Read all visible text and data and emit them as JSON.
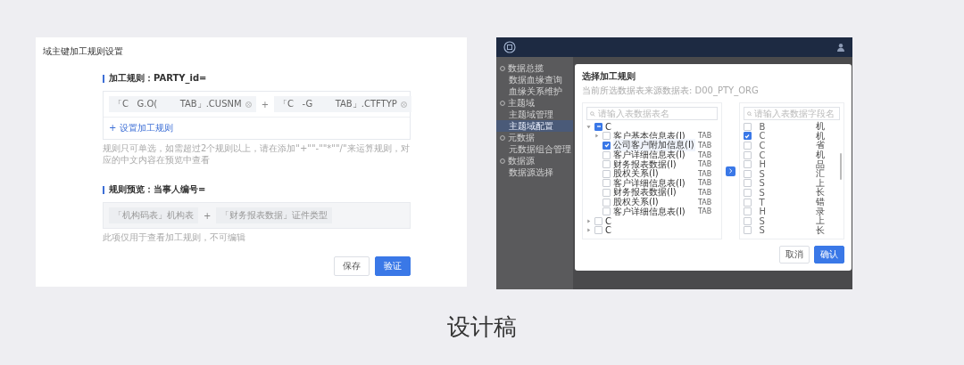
{
  "rule_settings": {
    "title": "域主键加工规则设置",
    "rule_heading": "加工规则：PARTY_id=",
    "rule_terms": [
      {
        "text": "「C   G.O(        TAB」.CUSNM"
      },
      {
        "text": "「C   -G        TAB」.CTFTYP"
      }
    ],
    "operator": "+",
    "add_rule_link": "+ 设置加工规则",
    "hint": "规则只可单选，如需超过2个规则以上，请在添加\"+\"\"-\"\"*\"\"/\"来运算规则，对应的中文内容在预览中查看",
    "preview_heading": "规则预览：当事人编号=",
    "preview_terms": [
      "「机构码表」机构表",
      "「财务报表数据」证件类型"
    ],
    "preview_operator": "+",
    "preview_hint": "此项仅用于查看加工规则，不可编辑",
    "buttons": [
      {
        "label": "保存",
        "kind": "secondary"
      },
      {
        "label": "验证",
        "kind": "primary"
      }
    ]
  },
  "app": {
    "sidebar": {
      "items": [
        {
          "label": "数据总揽",
          "kind": "section",
          "selected": false
        },
        {
          "label": "数据血缘查询",
          "kind": "item",
          "selected": false
        },
        {
          "label": "血缘关系维护",
          "kind": "item",
          "selected": false
        },
        {
          "label": "主题域",
          "kind": "section",
          "selected": false
        },
        {
          "label": "主题域管理",
          "kind": "item",
          "selected": false
        },
        {
          "label": "主题域配置",
          "kind": "item",
          "selected": true
        },
        {
          "label": "元数据",
          "kind": "section",
          "selected": false
        },
        {
          "label": "元数据组合管理",
          "kind": "item",
          "selected": false
        },
        {
          "label": "数据源",
          "kind": "section",
          "selected": false
        },
        {
          "label": "数据源选择",
          "kind": "item",
          "selected": false
        }
      ]
    },
    "modal": {
      "title": "选择加工规则",
      "subtitle": "当前所选数据表来源数据表: D00_PTY_ORG",
      "source_search": {
        "placeholder": "请输入表数据表名"
      },
      "tree": [
        {
          "label": "C",
          "checked": true,
          "indeterminate": true,
          "expanded": true,
          "children": [
            {
              "label": "客户基本信息表(I)",
              "tag": "TAB",
              "checked": false,
              "expanded": false
            },
            {
              "label": "公司客户附加信息(I)",
              "tag": "TAB",
              "checked": true
            },
            {
              "label": "客户详细信息表(I)",
              "tag": "TAB",
              "checked": false
            },
            {
              "label": "财务报表数据(I)",
              "tag": "TAB",
              "checked": false
            },
            {
              "label": "股权关系(I)",
              "tag": "TAB",
              "checked": false
            },
            {
              "label": "客户详细信息表(I)",
              "tag": "TAB",
              "checked": false
            },
            {
              "label": "财务报表数据(I)",
              "tag": "TAB",
              "checked": false
            },
            {
              "label": "股权关系(I)",
              "tag": "TAB",
              "checked": false
            },
            {
              "label": "客户详细信息表(I)",
              "tag": "TAB",
              "checked": false
            }
          ]
        },
        {
          "label": "C",
          "checked": false,
          "expanded": false
        },
        {
          "label": "C",
          "checked": false,
          "expanded": false
        }
      ],
      "target_search": {
        "placeholder": "请输入表数据字段名"
      },
      "fields": [
        {
          "code": "B",
          "name": "机",
          "checked": false
        },
        {
          "code": "C",
          "name": "机",
          "checked": true
        },
        {
          "code": "C",
          "name": "省",
          "checked": false
        },
        {
          "code": "C",
          "name": "机",
          "checked": false
        },
        {
          "code": "H",
          "name": "品",
          "checked": false
        },
        {
          "code": "S",
          "name": "汇",
          "checked": false
        },
        {
          "code": "S",
          "name": "上",
          "checked": false
        },
        {
          "code": "S",
          "name": "长",
          "checked": false
        },
        {
          "code": "T",
          "name": "错",
          "checked": false
        },
        {
          "code": "H",
          "name": "录",
          "checked": false
        },
        {
          "code": "S",
          "name": "上",
          "checked": false
        },
        {
          "code": "S",
          "name": "长",
          "checked": false
        }
      ],
      "buttons": [
        {
          "label": "取消",
          "kind": "secondary"
        },
        {
          "label": "确认",
          "kind": "primary"
        }
      ]
    }
  },
  "caption": "设计稿"
}
